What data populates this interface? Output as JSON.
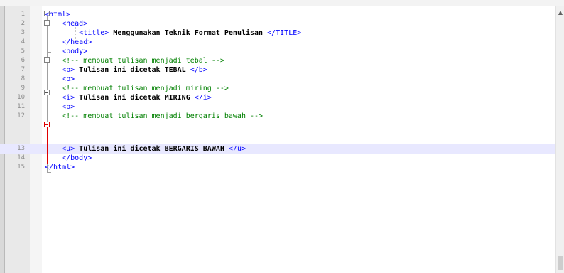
{
  "editor": {
    "lines": [
      {
        "num": "1",
        "indent": "",
        "parts": [
          {
            "t": "<html>",
            "c": "tag"
          }
        ]
      },
      {
        "num": "2",
        "indent": "    ",
        "parts": [
          {
            "t": "<head>",
            "c": "tag"
          }
        ]
      },
      {
        "num": "3",
        "indent": "        ",
        "parts": [
          {
            "t": "<title>",
            "c": "tag"
          },
          {
            "t": " Menggunakan Teknik Format Penulisan ",
            "c": "bold"
          },
          {
            "t": "</TITLE>",
            "c": "tag"
          }
        ]
      },
      {
        "num": "4",
        "indent": "    ",
        "parts": [
          {
            "t": "</head>",
            "c": "tag"
          }
        ]
      },
      {
        "num": "5",
        "indent": "    ",
        "parts": [
          {
            "t": "<body>",
            "c": "tag"
          }
        ]
      },
      {
        "num": "6",
        "indent": "    ",
        "parts": [
          {
            "t": "<!-- membuat tulisan menjadi tebal -->",
            "c": "cmt"
          }
        ]
      },
      {
        "num": "7",
        "indent": "    ",
        "parts": [
          {
            "t": "<b>",
            "c": "tag"
          },
          {
            "t": " Tulisan ini dicetak TEBAL ",
            "c": "bold"
          },
          {
            "t": "</b>",
            "c": "tag"
          }
        ]
      },
      {
        "num": "8",
        "indent": "    ",
        "parts": [
          {
            "t": "<p>",
            "c": "tag"
          }
        ]
      },
      {
        "num": "9",
        "indent": "    ",
        "parts": [
          {
            "t": "<!-- membuat tulisan menjadi miring -->",
            "c": "cmt"
          }
        ]
      },
      {
        "num": "10",
        "indent": "    ",
        "parts": [
          {
            "t": "<i>",
            "c": "tag"
          },
          {
            "t": " Tulisan ini dicetak MIRING ",
            "c": "bold"
          },
          {
            "t": "</i>",
            "c": "tag"
          }
        ]
      },
      {
        "num": "11",
        "indent": "    ",
        "parts": [
          {
            "t": "<p>",
            "c": "tag"
          }
        ]
      },
      {
        "num": "12",
        "indent": "    ",
        "parts": [
          {
            "t": "<!-- membuat tulisan menjadi bergaris bawah -->",
            "c": "cmt"
          }
        ]
      },
      {
        "num": "13",
        "indent": "    ",
        "parts": [
          {
            "t": "<u>",
            "c": "tag"
          },
          {
            "t": " Tulisan ini dicetak BERGARIS BAWAH ",
            "c": "bold"
          },
          {
            "t": "</u>",
            "c": "tag"
          }
        ]
      },
      {
        "num": "14",
        "indent": "    ",
        "parts": [
          {
            "t": "</body>",
            "c": "tag"
          }
        ]
      },
      {
        "num": "15",
        "indent": "",
        "parts": [
          {
            "t": "</html>",
            "c": "tag"
          }
        ]
      }
    ],
    "current_line": "13"
  },
  "scrollbar": {
    "up_arrow_icon": "chevron-up-icon"
  }
}
